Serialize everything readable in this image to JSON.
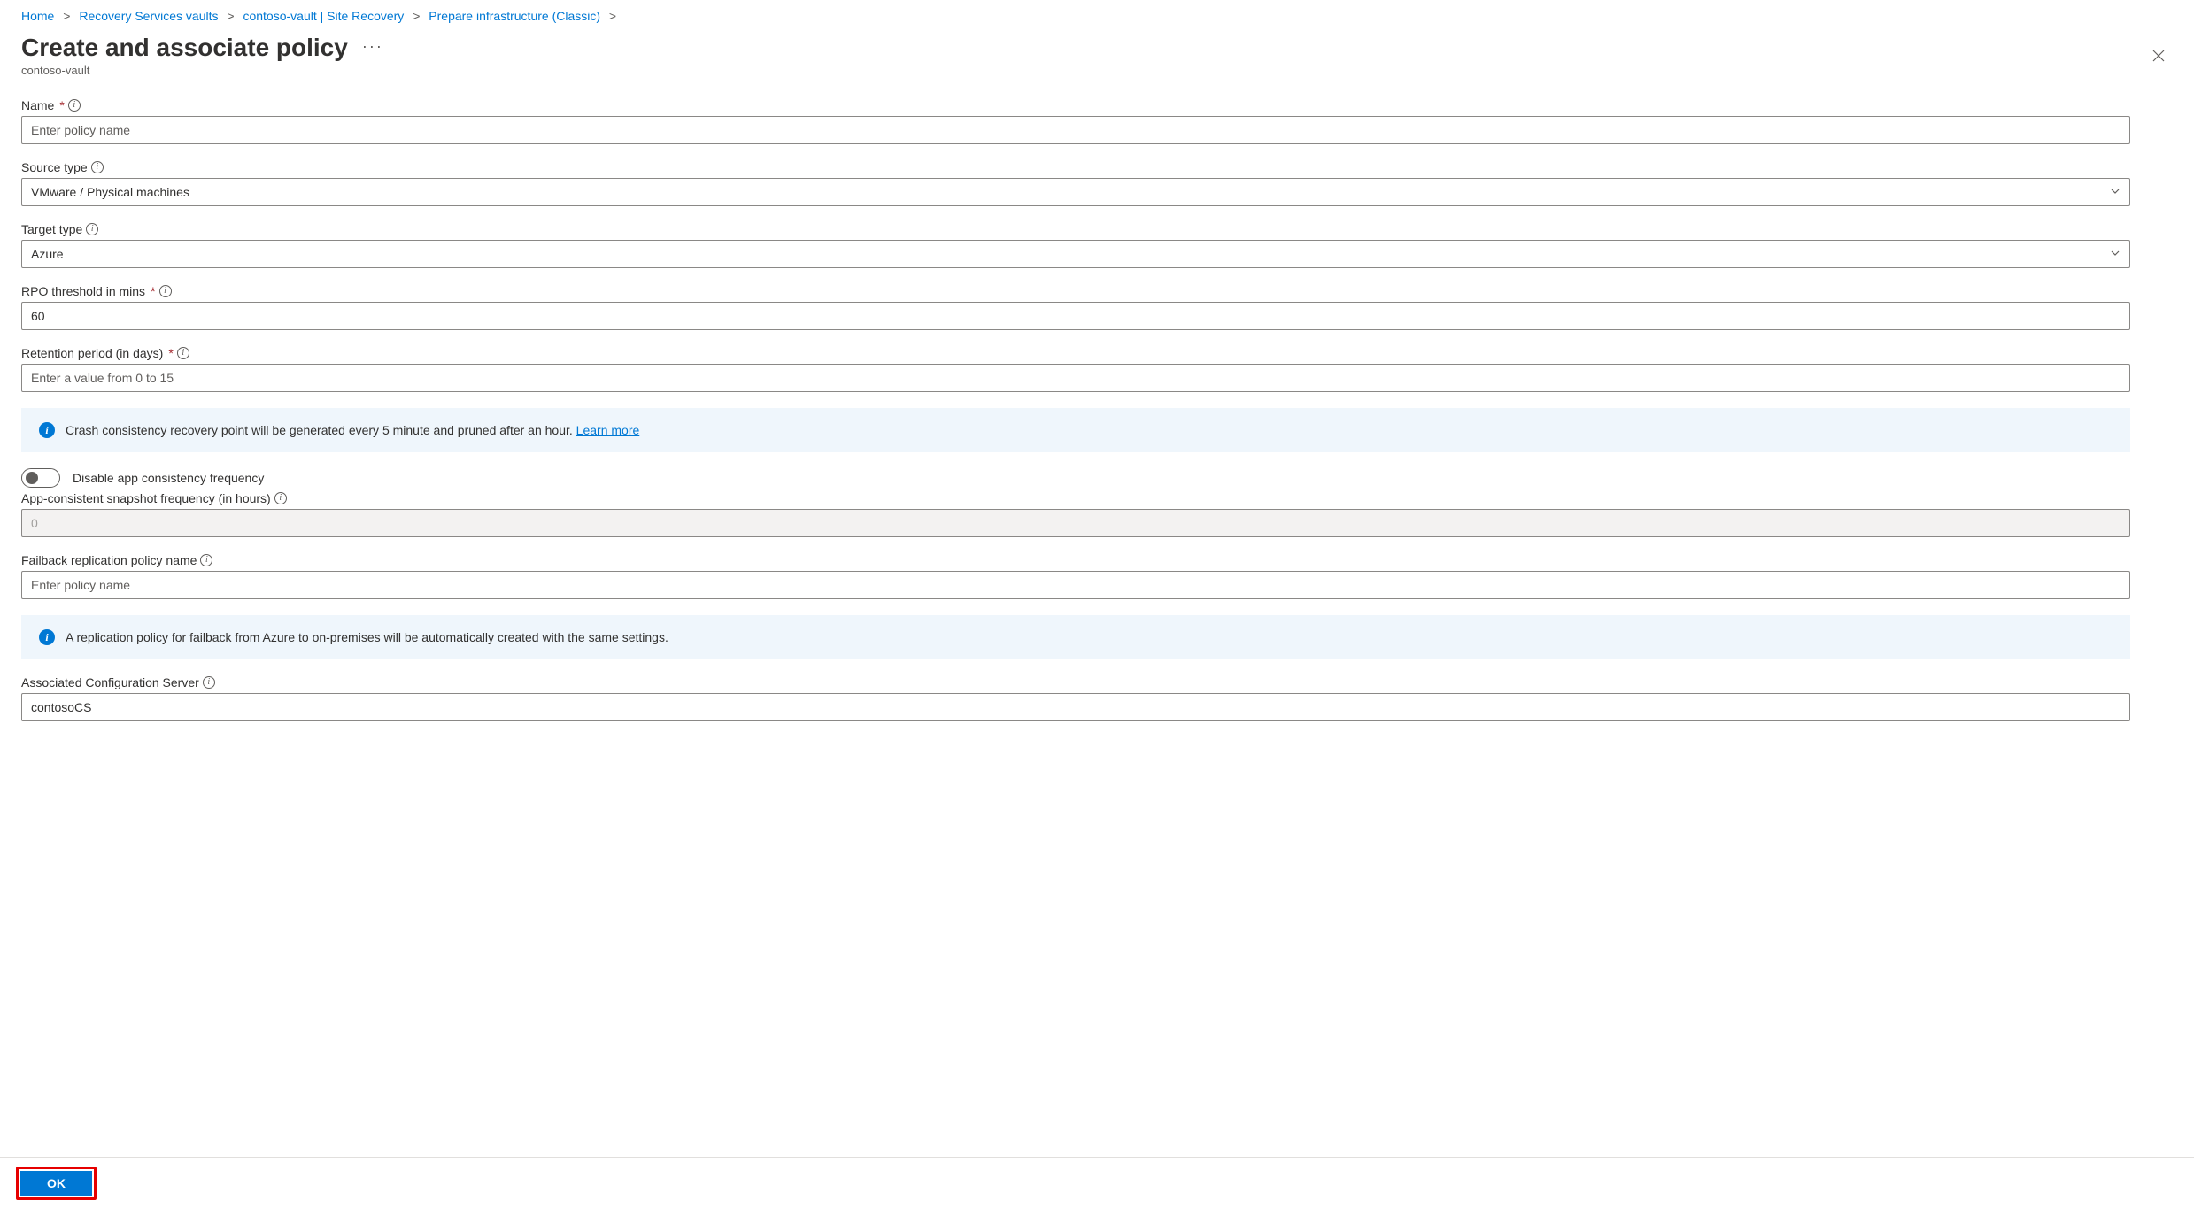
{
  "breadcrumb": {
    "items": [
      "Home",
      "Recovery Services vaults",
      "contoso-vault | Site Recovery",
      "Prepare infrastructure (Classic)"
    ]
  },
  "header": {
    "title": "Create and associate policy",
    "subtitle": "contoso-vault"
  },
  "fields": {
    "name": {
      "label": "Name",
      "placeholder": "Enter policy name",
      "value": ""
    },
    "source_type": {
      "label": "Source type",
      "value": "VMware / Physical machines"
    },
    "target_type": {
      "label": "Target type",
      "value": "Azure"
    },
    "rpo": {
      "label": "RPO threshold in mins",
      "value": "60"
    },
    "retention": {
      "label": "Retention period (in days)",
      "placeholder": "Enter a value from 0 to 15",
      "value": ""
    },
    "crash_info": {
      "text": "Crash consistency recovery point will be generated every 5 minute and pruned after an hour.",
      "link": "Learn more"
    },
    "toggle_label": "Disable app consistency frequency",
    "app_freq": {
      "label": "App-consistent snapshot frequency (in hours)",
      "value": "0"
    },
    "failback": {
      "label": "Failback replication policy name",
      "placeholder": "Enter policy name",
      "value": ""
    },
    "failback_info": {
      "text": "A replication policy for failback from Azure to on-premises will be automatically created with the same settings."
    },
    "config_server": {
      "label": "Associated Configuration Server",
      "value": "contosoCS"
    }
  },
  "footer": {
    "ok": "OK"
  }
}
